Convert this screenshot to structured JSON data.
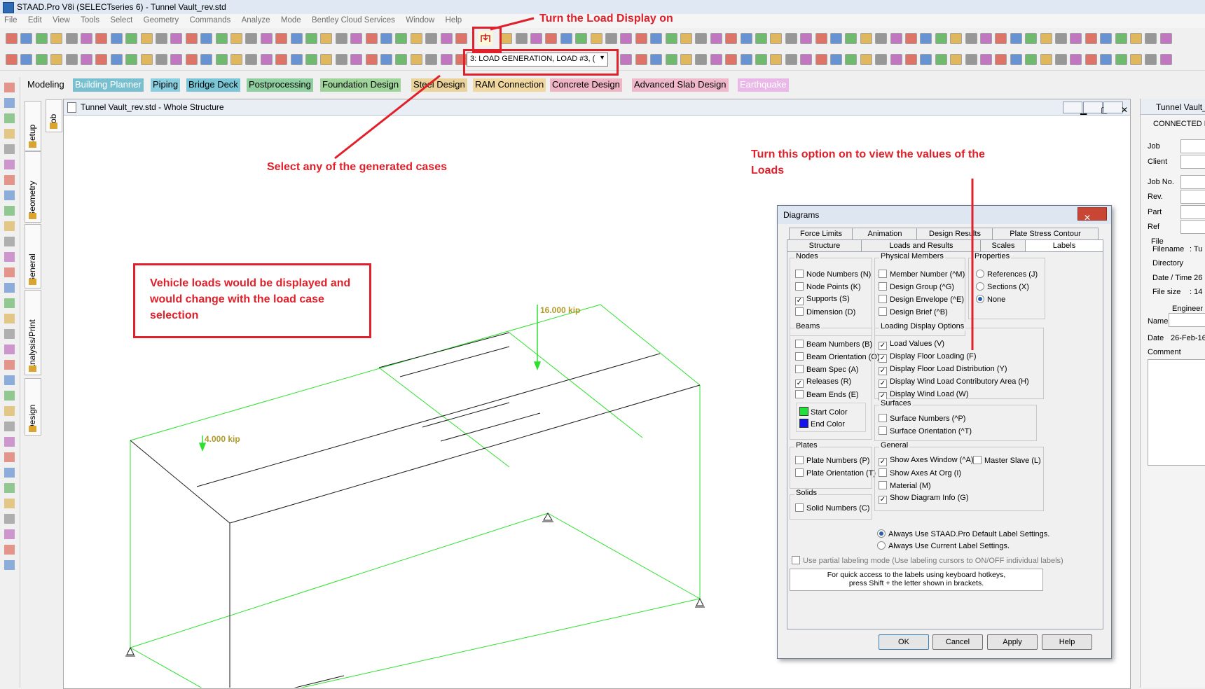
{
  "titlebar": {
    "title": "STAAD.Pro V8i (SELECTseries 6) - Tunnel Vault_rev.std"
  },
  "menubar": {
    "items": [
      "File",
      "Edit",
      "View",
      "Tools",
      "Select",
      "Geometry",
      "Commands",
      "Analyze",
      "Mode",
      "Bentley Cloud Services",
      "Window",
      "Help"
    ]
  },
  "toolbar": {
    "load_case_selected": "3: LOAD GENERATION, LOAD #3, ("
  },
  "mode_tabs": [
    {
      "label": "Modeling",
      "bg": "transparent",
      "color": "#000000"
    },
    {
      "label": "Building Planner",
      "bg": "#78c0d0",
      "color": "#ffffff"
    },
    {
      "label": "Piping",
      "bg": "#89cfe0",
      "color": "#000000"
    },
    {
      "label": "Bridge Deck",
      "bg": "#7ac6d6",
      "color": "#000000"
    },
    {
      "label": "Postprocessing",
      "bg": "#90d0a0",
      "color": "#000000"
    },
    {
      "label": "Foundation Design",
      "bg": "#9ed49a",
      "color": "#000000"
    },
    {
      "label": "Steel Design",
      "bg": "#ead39a",
      "color": "#000000"
    },
    {
      "label": "RAM Connection",
      "bg": "#f0d8a0",
      "color": "#000000"
    },
    {
      "label": "Concrete Design",
      "bg": "#efb5c4",
      "color": "#000000"
    },
    {
      "label": "Advanced Slab Design",
      "bg": "#efb8cb",
      "color": "#000000"
    },
    {
      "label": "Earthquake",
      "bg": "#e9b8e8",
      "color": "#ffffff"
    }
  ],
  "side_tabs": [
    "Job",
    "Setup",
    "Geometry",
    "General",
    "Analysis/Print",
    "Design"
  ],
  "side_tab_icons": [
    "question-icon",
    "setup-icon",
    "geometry-icon",
    "general-icon",
    "analysis-icon",
    "design-icon"
  ],
  "view_window": {
    "title": "Tunnel Vault_rev.std - Whole Structure"
  },
  "loads": {
    "load1": "16.000 kip",
    "load2": "4.000 kip"
  },
  "right_panel": {
    "title": "Tunnel Vault_",
    "connected": "CONNECTED P",
    "fields": [
      "Job",
      "Client",
      "Job No.",
      "Rev.",
      "Part",
      "Ref"
    ],
    "file_label": "File",
    "file_fields": [
      "Filename",
      "Directory",
      "Date / Time",
      "File size"
    ],
    "file_values": [
      ": Tu",
      ": 26",
      ": 14"
    ],
    "engineer_label": "Engineer",
    "name_label": "Name",
    "date_label": "Date",
    "date_value": "26-Feb-16",
    "comment_label": "Comment"
  },
  "dialog": {
    "title": "Diagrams",
    "tabs_row1": [
      "Force Limits",
      "Animation",
      "Design Results",
      "Plate Stress Contour"
    ],
    "tabs_row2": [
      "Structure",
      "Loads and Results",
      "Scales",
      "Labels"
    ],
    "groups": {
      "nodes": {
        "title": "Nodes",
        "options": [
          {
            "label": "Node Numbers (N)",
            "checked": false
          },
          {
            "label": "Node Points (K)",
            "checked": false
          },
          {
            "label": "Supports (S)",
            "checked": true
          },
          {
            "label": "Dimension (D)",
            "checked": false
          }
        ]
      },
      "physical": {
        "title": "Physical Members",
        "options": [
          {
            "label": "Member Number (^M)",
            "checked": false
          },
          {
            "label": "Design Group (^G)",
            "checked": false
          },
          {
            "label": "Design Envelope (^E)",
            "checked": false
          },
          {
            "label": "Design Brief (^B)",
            "checked": false
          }
        ]
      },
      "properties": {
        "title": "Properties",
        "options": [
          {
            "label": "References (J)",
            "checked": false
          },
          {
            "label": "Sections (X)",
            "checked": false
          },
          {
            "label": "None",
            "checked": true
          }
        ]
      },
      "beams": {
        "title": "Beams",
        "options": [
          {
            "label": "Beam Numbers (B)",
            "checked": false
          },
          {
            "label": "Beam Orientation (O)",
            "checked": false
          },
          {
            "label": "Beam Spec (A)",
            "checked": false
          },
          {
            "label": "Releases (R)",
            "checked": true
          },
          {
            "label": "Beam Ends (E)",
            "checked": false
          }
        ],
        "start_color": "Start Color",
        "end_color": "End Color",
        "start_hex": "#22e03a",
        "end_hex": "#1111ee"
      },
      "loading": {
        "title": "Loading Display Options",
        "options": [
          {
            "label": "Load Values (V)",
            "checked": true
          },
          {
            "label": "Display Floor Loading (F)",
            "checked": true
          },
          {
            "label": "Display Floor Load Distribution (Y)",
            "checked": true
          },
          {
            "label": "Display Wind Load Contributory Area (H)",
            "checked": true
          },
          {
            "label": "Display Wind Load (W)",
            "checked": true
          }
        ]
      },
      "surfaces": {
        "title": "Surfaces",
        "options": [
          {
            "label": "Surface Numbers (^P)",
            "checked": false
          },
          {
            "label": "Surface Orientation (^T)",
            "checked": false
          }
        ]
      },
      "plates": {
        "title": "Plates",
        "options": [
          {
            "label": "Plate Numbers (P)",
            "checked": false
          },
          {
            "label": "Plate Orientation (T)",
            "checked": false
          }
        ]
      },
      "general": {
        "title": "General",
        "options": [
          {
            "label": "Show Axes Window (^A)",
            "checked": true
          },
          {
            "label": "Master Slave (L)",
            "checked": false
          },
          {
            "label": "Show Axes At Org (I)",
            "checked": false
          },
          {
            "label": "Material (M)",
            "checked": false
          },
          {
            "label": "Show Diagram Info (G)",
            "checked": true
          }
        ]
      },
      "solids": {
        "title": "Solids",
        "options": [
          {
            "label": "Solid Numbers (C)",
            "checked": false
          }
        ]
      }
    },
    "radio_defaults": [
      {
        "label": "Always Use STAAD.Pro Default Label Settings.",
        "selected": true
      },
      {
        "label": "Always Use Current Label Settings.",
        "selected": false
      }
    ],
    "partial_mode": "Use partial labeling mode (Use labeling cursors to ON/OFF individual labels)",
    "hint_line1": "For quick access to the labels using keyboard hotkeys,",
    "hint_line2": "press Shift + the letter shown in brackets.",
    "buttons": {
      "ok": "OK",
      "cancel": "Cancel",
      "apply": "Apply",
      "help": "Help"
    }
  },
  "annotations": {
    "load_display": "Turn the Load Display on",
    "select_case": "Select any of the generated cases",
    "load_values_line1": "Turn this option on to view the values of the",
    "load_values_line2": "Loads",
    "vehicle_line1": "Vehicle loads would be displayed and",
    "vehicle_line2": "would change with the load case",
    "vehicle_line3": "selection"
  },
  "colors": {
    "annotation_red": "#e0202b",
    "structure_green": "#2ee02e",
    "load_arrow": "#2ee02e",
    "load_label": "#b09a2a"
  }
}
